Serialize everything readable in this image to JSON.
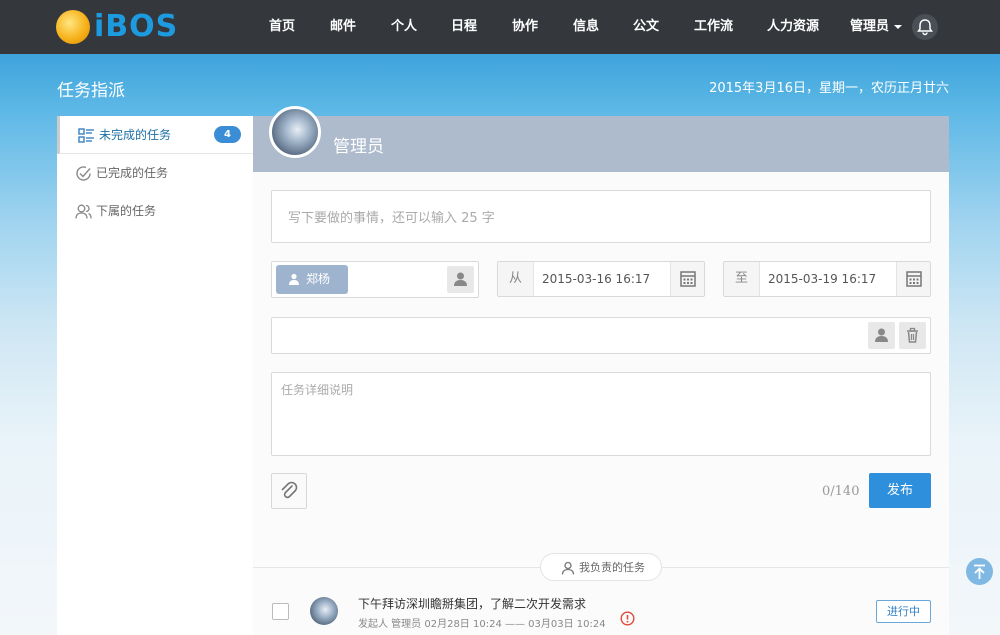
{
  "brand": {
    "logo_text": "iBOS"
  },
  "nav": {
    "items": [
      "首页",
      "邮件",
      "个人",
      "日程",
      "协作",
      "信息",
      "公文",
      "工作流",
      "人力资源",
      "管理员"
    ]
  },
  "header": {
    "title": "任务指派",
    "date": "2015年3月16日，星期一，农历正月廿六"
  },
  "sidebar": {
    "items": [
      {
        "label": "未完成的任务",
        "badge": "4",
        "icon": "task-list-icon"
      },
      {
        "label": "已完成的任务",
        "icon": "check-circle-icon"
      },
      {
        "label": "下属的任务",
        "icon": "users-icon"
      }
    ]
  },
  "composer": {
    "user_name": "管理员",
    "task_placeholder": "写下要做的事情，还可以输入 25 字",
    "assignee": "郑杨",
    "from_label": "从",
    "start_date": "2015-03-16 16:17",
    "to_label": "至",
    "end_date": "2015-03-19 16:17",
    "detail_placeholder": "任务详细说明",
    "char_count": "0/140",
    "publish_label": "发布"
  },
  "tasks": {
    "section_label": "我负责的任务",
    "items": [
      {
        "title": "下午拜访深圳瞻掰集团，了解二次开发需求",
        "meta": "发起人 管理员 02月28日 10:24 —— 03月03日 10:24",
        "status": "进行中"
      }
    ]
  },
  "colors": {
    "topbar": "#34383d",
    "accent": "#2e8fdc",
    "header_band": "#aebbcd"
  }
}
